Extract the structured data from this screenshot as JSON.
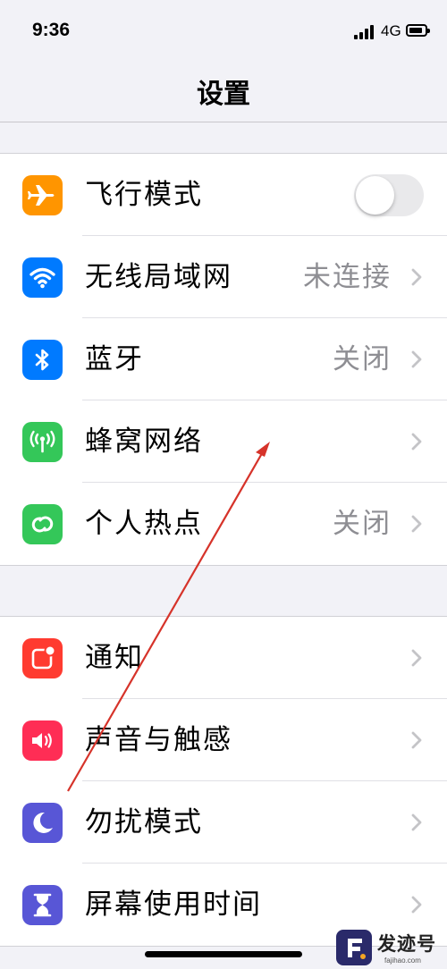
{
  "status_bar": {
    "time": "9:36",
    "network": "4G"
  },
  "header": {
    "title": "设置"
  },
  "groups": [
    {
      "items": [
        {
          "label": "飞行模式",
          "icon": "airplane-icon",
          "color": "#ff9500",
          "control": "toggle",
          "toggle_on": false
        },
        {
          "label": "无线局域网",
          "value": "未连接",
          "icon": "wifi-icon",
          "color": "#007aff"
        },
        {
          "label": "蓝牙",
          "value": "关闭",
          "icon": "bluetooth-icon",
          "color": "#007aff"
        },
        {
          "label": "蜂窝网络",
          "value": "",
          "icon": "cellular-antenna-icon",
          "color": "#34c759"
        },
        {
          "label": "个人热点",
          "value": "关闭",
          "icon": "hotspot-link-icon",
          "color": "#34c759"
        }
      ]
    },
    {
      "items": [
        {
          "label": "通知",
          "value": "",
          "icon": "notification-icon",
          "color": "#ff3b30"
        },
        {
          "label": "声音与触感",
          "value": "",
          "icon": "speaker-icon",
          "color": "#ff2d55"
        },
        {
          "label": "勿扰模式",
          "value": "",
          "icon": "moon-icon",
          "color": "#5856d6"
        },
        {
          "label": "屏幕使用时间",
          "value": "",
          "icon": "hourglass-icon",
          "color": "#5856d6"
        }
      ]
    }
  ],
  "watermark": {
    "name": "发迹号",
    "domain": "fajihao.com"
  },
  "annotation_color": "#d6332a"
}
